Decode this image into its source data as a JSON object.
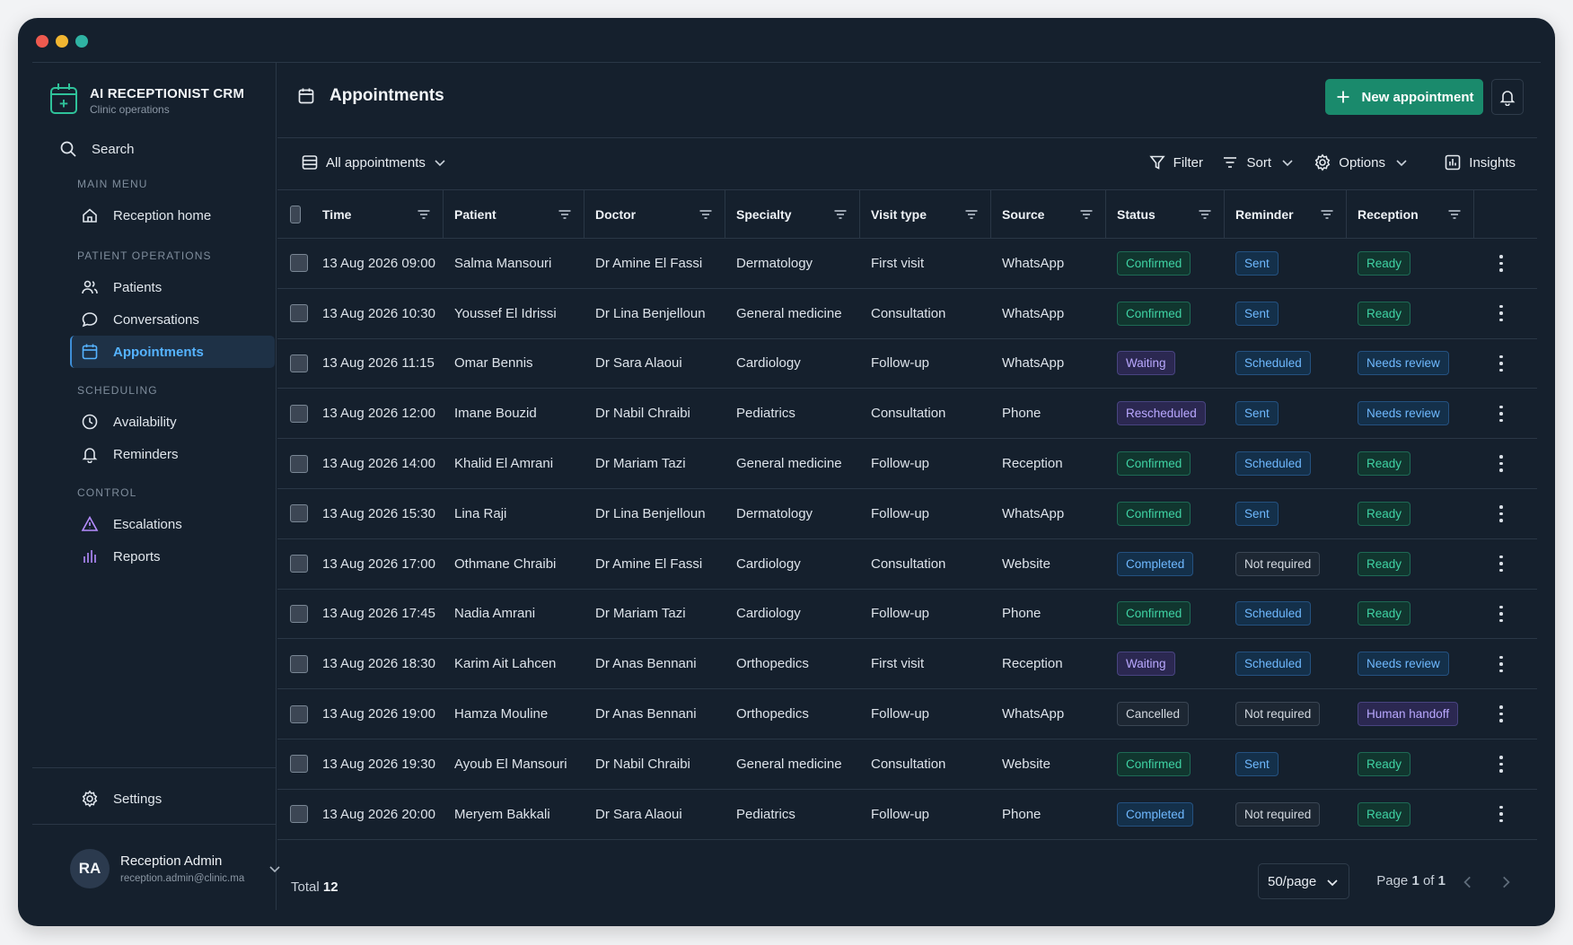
{
  "app": {
    "title": "AI RECEPTIONIST CRM",
    "subtitle": "Clinic operations"
  },
  "sidebar": {
    "search_label": "Search",
    "sections": [
      {
        "label": "MAIN MENU",
        "items": [
          {
            "label": "Reception home",
            "icon": "home-icon"
          }
        ]
      },
      {
        "label": "PATIENT OPERATIONS",
        "items": [
          {
            "label": "Patients",
            "icon": "users-icon"
          },
          {
            "label": "Conversations",
            "icon": "chat-icon"
          },
          {
            "label": "Appointments",
            "icon": "calendar-icon",
            "active": true
          }
        ]
      },
      {
        "label": "SCHEDULING",
        "items": [
          {
            "label": "Availability",
            "icon": "clock-icon"
          },
          {
            "label": "Reminders",
            "icon": "bell-icon"
          }
        ]
      },
      {
        "label": "CONTROL",
        "items": [
          {
            "label": "Escalations",
            "icon": "warning-icon"
          },
          {
            "label": "Reports",
            "icon": "bar-chart-icon"
          }
        ]
      }
    ],
    "settings_label": "Settings",
    "user": {
      "initials": "RA",
      "name": "Reception Admin",
      "email": "reception.admin@clinic.ma"
    }
  },
  "header": {
    "title": "Appointments",
    "new_button": "New appointment"
  },
  "toolbar": {
    "view_label": "All appointments",
    "filter": "Filter",
    "sort": "Sort",
    "options": "Options",
    "insights": "Insights"
  },
  "table": {
    "columns": [
      "Time",
      "Patient",
      "Doctor",
      "Specialty",
      "Visit type",
      "Source",
      "Status",
      "Reminder",
      "Reception"
    ],
    "rows": [
      {
        "time": "13 Aug 2026 09:00",
        "patient": "Salma Mansouri",
        "doctor": "Dr Amine El Fassi",
        "specialty": "Dermatology",
        "visit": "First visit",
        "source": "WhatsApp",
        "status": "Confirmed",
        "reminder": "Sent",
        "reception": "Ready"
      },
      {
        "time": "13 Aug 2026 10:30",
        "patient": "Youssef El Idrissi",
        "doctor": "Dr Lina Benjelloun",
        "specialty": "General medicine",
        "visit": "Consultation",
        "source": "WhatsApp",
        "status": "Confirmed",
        "reminder": "Sent",
        "reception": "Ready"
      },
      {
        "time": "13 Aug 2026 11:15",
        "patient": "Omar Bennis",
        "doctor": "Dr Sara Alaoui",
        "specialty": "Cardiology",
        "visit": "Follow-up",
        "source": "WhatsApp",
        "status": "Waiting",
        "reminder": "Scheduled",
        "reception": "Needs review"
      },
      {
        "time": "13 Aug 2026 12:00",
        "patient": "Imane Bouzid",
        "doctor": "Dr Nabil Chraibi",
        "specialty": "Pediatrics",
        "visit": "Consultation",
        "source": "Phone",
        "status": "Rescheduled",
        "reminder": "Sent",
        "reception": "Needs review"
      },
      {
        "time": "13 Aug 2026 14:00",
        "patient": "Khalid El Amrani",
        "doctor": "Dr Mariam Tazi",
        "specialty": "General medicine",
        "visit": "Follow-up",
        "source": "Reception",
        "status": "Confirmed",
        "reminder": "Scheduled",
        "reception": "Ready"
      },
      {
        "time": "13 Aug 2026 15:30",
        "patient": "Lina Raji",
        "doctor": "Dr Lina Benjelloun",
        "specialty": "Dermatology",
        "visit": "Follow-up",
        "source": "WhatsApp",
        "status": "Confirmed",
        "reminder": "Sent",
        "reception": "Ready"
      },
      {
        "time": "13 Aug 2026 17:00",
        "patient": "Othmane Chraibi",
        "doctor": "Dr Amine El Fassi",
        "specialty": "Cardiology",
        "visit": "Consultation",
        "source": "Website",
        "status": "Completed",
        "reminder": "Not required",
        "reception": "Ready"
      },
      {
        "time": "13 Aug 2026 17:45",
        "patient": "Nadia Amrani",
        "doctor": "Dr Mariam Tazi",
        "specialty": "Cardiology",
        "visit": "Follow-up",
        "source": "Phone",
        "status": "Confirmed",
        "reminder": "Scheduled",
        "reception": "Ready"
      },
      {
        "time": "13 Aug 2026 18:30",
        "patient": "Karim Ait Lahcen",
        "doctor": "Dr Anas Bennani",
        "specialty": "Orthopedics",
        "visit": "First visit",
        "source": "Reception",
        "status": "Waiting",
        "reminder": "Scheduled",
        "reception": "Needs review"
      },
      {
        "time": "13 Aug 2026 19:00",
        "patient": "Hamza Mouline",
        "doctor": "Dr Anas Bennani",
        "specialty": "Orthopedics",
        "visit": "Follow-up",
        "source": "WhatsApp",
        "status": "Cancelled",
        "reminder": "Not required",
        "reception": "Human handoff"
      },
      {
        "time": "13 Aug 2026 19:30",
        "patient": "Ayoub El Mansouri",
        "doctor": "Dr Nabil Chraibi",
        "specialty": "General medicine",
        "visit": "Consultation",
        "source": "Website",
        "status": "Confirmed",
        "reminder": "Sent",
        "reception": "Ready"
      },
      {
        "time": "13 Aug 2026 20:00",
        "patient": "Meryem Bakkali",
        "doctor": "Dr Sara Alaoui",
        "specialty": "Pediatrics",
        "visit": "Follow-up",
        "source": "Phone",
        "status": "Completed",
        "reminder": "Not required",
        "reception": "Ready"
      }
    ]
  },
  "footer": {
    "total_label": "Total",
    "total_value": "12",
    "per_page": "50/page",
    "page_prefix": "Page",
    "page_current": "1",
    "page_of": "of",
    "page_total": "1"
  },
  "colors": {
    "accent": "#1a8a6c",
    "background": "#15202d",
    "active_nav": "#55b3ff"
  }
}
